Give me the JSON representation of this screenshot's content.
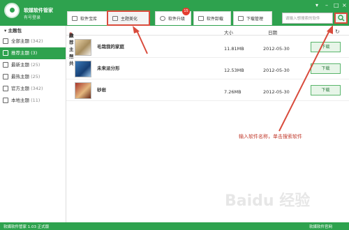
{
  "title": {
    "app_name": "软媒软件管家",
    "login_text": "有号登录"
  },
  "tabs": [
    {
      "label": "软件宝库"
    },
    {
      "label": "主题美化"
    },
    {
      "label": "软件升级",
      "badge": "15"
    },
    {
      "label": "软件卸载"
    },
    {
      "label": "下载管理"
    }
  ],
  "search": {
    "placeholder": "请输入想搜索的软件"
  },
  "sidebar": {
    "header": "主题包",
    "items": [
      {
        "label": "全部主题",
        "count": "(342)"
      },
      {
        "label": "推荐主题",
        "count": "(3)"
      },
      {
        "label": "最新主题",
        "count": "(25)"
      },
      {
        "label": "最热主题",
        "count": "(25)"
      },
      {
        "label": "官方主题",
        "count": "(342)"
      },
      {
        "label": "本地主题",
        "count": "(11)"
      }
    ]
  },
  "list": {
    "header_prefix": "推荐主题共",
    "header_count": "3",
    "header_suffix": "款",
    "col_size": "大小",
    "col_date": "日期",
    "rows": [
      {
        "name": "毛哉我的家庭",
        "size": "11.81MB",
        "date": "2012-05-30",
        "action": "下载"
      },
      {
        "name": "未来派分形",
        "size": "12.53MB",
        "date": "2012-05-30",
        "action": "下载"
      },
      {
        "name": "砂岩",
        "size": "7.26MB",
        "date": "2012-05-30",
        "action": "下载"
      }
    ]
  },
  "annotation": "输入软件名称，单击搜索软件",
  "status": {
    "left": "软媒软件管家 1.03 正式版",
    "right": "软媒软件官网"
  },
  "watermark": "Baidu 经验",
  "colors": {
    "brand_green": "#2ea24e",
    "annotation_red": "#d94b3c"
  }
}
